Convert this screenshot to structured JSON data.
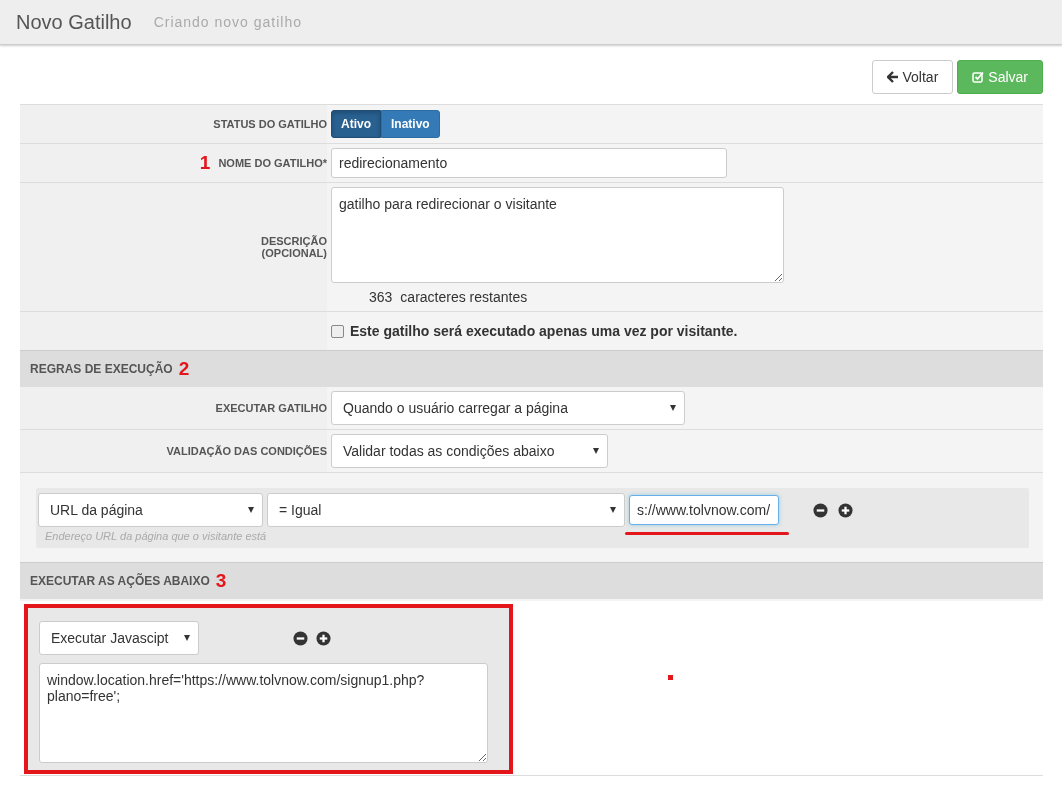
{
  "header": {
    "title": "Novo Gatilho",
    "subtitle": "Criando novo gatilho"
  },
  "buttons": [
    {
      "label": "Voltar",
      "kind": "back"
    },
    {
      "label": "Salvar",
      "kind": "save"
    }
  ],
  "status": {
    "label": "STATUS DO GATILHO",
    "options": [
      {
        "label": "Ativo",
        "selected": true
      },
      {
        "label": "Inativo",
        "selected": false
      }
    ]
  },
  "name_field": {
    "label": "NOME DO GATILHO*",
    "annotation": "1",
    "value": "redirecionamento"
  },
  "description": {
    "label": "DESCRIÇÃO (OPCIONAL)",
    "value": "gatilho para redirecionar o visitante",
    "counter": "363",
    "counter_text": "caracteres restantes"
  },
  "once_checkbox": {
    "label": "Este gatilho será executado apenas uma vez por visitante.",
    "checked": false
  },
  "rules_section": {
    "title": "REGRAS DE EXECUÇÃO",
    "annotation": "2",
    "fields": [
      {
        "label": "EXECUTAR GATILHO",
        "value": "Quando o usuário carregar a página"
      },
      {
        "label": "VALIDAÇÃO DAS CONDIÇÕES",
        "value": "Validar todas as condições abaixo"
      }
    ],
    "condition": {
      "field": "URL da página",
      "operator": "= Igual",
      "value": "s://www.tolvnow.com/",
      "underlined": true,
      "hint": "Endereço URL da página que o visitante está"
    }
  },
  "actions_section": {
    "title": "EXECUTAR AS AÇÕES ABAIXO",
    "annotation": "3",
    "action": {
      "type": "Executar Javascipt",
      "code": "window.location.href='https://www.tolvnow.com/signup1.php?plano=free';",
      "highlighted": true
    }
  }
}
